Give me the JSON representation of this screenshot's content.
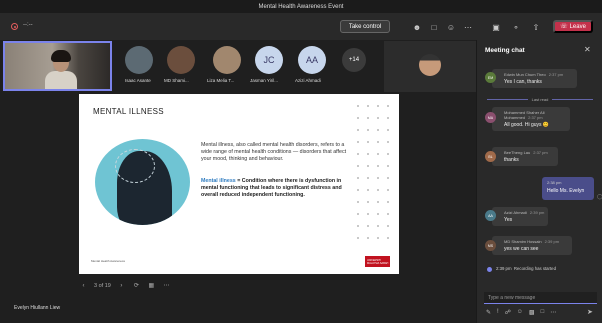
{
  "window": {
    "title": "Mental Health Awareness Event"
  },
  "topbar": {
    "timer": "--:--",
    "take_control_label": "Take control",
    "leave_label": "Leave",
    "icons": [
      "chat-icon",
      "people-icon",
      "reactions-icon",
      "more-icon",
      "camera-icon",
      "mic-icon",
      "share-icon",
      "phone-icon"
    ]
  },
  "participants": {
    "people": [
      {
        "name": "Isaac Asante",
        "initials": "",
        "color": "#5c6a73"
      },
      {
        "name": "MD Shami...",
        "initials": "",
        "color": "#6b4e3d"
      },
      {
        "name": "Liza Melia T...",
        "initials": "",
        "color": "#a1876e"
      },
      {
        "name": "Jasman Yiril...",
        "initials": "JC",
        "color": "#c7d6ec"
      },
      {
        "name": "Azizi Ahmadi",
        "initials": "AA",
        "color": "#c7d6ec"
      }
    ],
    "more_count": "+14"
  },
  "slide": {
    "title": "MENTAL ILLNESS",
    "description": "Mental illness, also called mental health disorders, refers to a wide range of mental health conditions — disorders that affect your mood, thinking and behaviour.",
    "definition_keyword": "Mental illness",
    "definition_text": " = Condition where there is dysfunction in mental functioning that leads to significant distress and overall reduced independent functioning.",
    "footer": "Mental Health Awareness",
    "logo_text": "UNIVERSITI MALAYSIA SABAH"
  },
  "slide_nav": {
    "page_label": "3 of 19"
  },
  "presenter": {
    "name": "Evelyn Hiullann Liew"
  },
  "chat": {
    "title": "Meeting chat",
    "last_read_label": "Last read",
    "messages": [
      {
        "sender": "Edwin Mun Chum Theo",
        "time": "2:37 pm",
        "text": "Yes I can, thanks",
        "initials": "EM",
        "color": "#5a7a3a"
      },
      {
        "sender": "Mohammed Shaher Ali Mohammed",
        "time": "2:37 pm",
        "text": "All good. Hi guys",
        "emoji": "😊",
        "initials": "MA",
        "color": "#8a4f6e"
      },
      {
        "sender": "BeeTheng Lau",
        "time": "2:37 pm",
        "text": "thanks",
        "initials": "BL",
        "color": "#a06a4a"
      },
      {
        "sender": "Azizi Ahmadi",
        "time": "2:39 pm",
        "text": "Yes",
        "initials": "AA",
        "color": "#4a7a8a"
      },
      {
        "sender": "MD Shamim Hossain",
        "time": "2:39 pm",
        "text": "yes we can see",
        "initials": "MS",
        "color": "#6b4e3d"
      }
    ],
    "own_message": {
      "time": "2:38 pm",
      "text": "Hello Ms. Evelyn"
    },
    "system_message": {
      "time": "2:39 pm",
      "text": "Recording has started"
    },
    "compose_placeholder": "Type a new message"
  }
}
